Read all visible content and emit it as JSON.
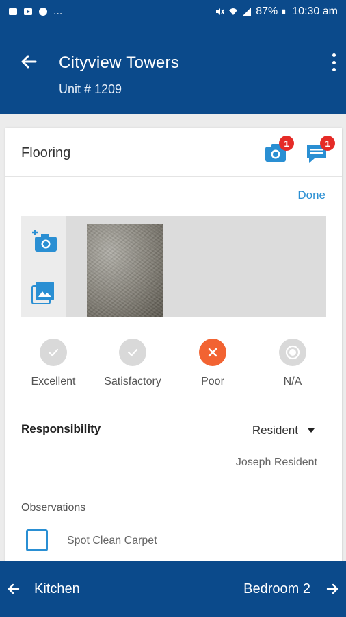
{
  "status_bar": {
    "battery": "87%",
    "time": "10:30 am",
    "overflow": "..."
  },
  "header": {
    "title": "Cityview Towers",
    "subtitle": "Unit # 1209"
  },
  "card": {
    "title": "Flooring",
    "camera_badge": "1",
    "comment_badge": "1",
    "done_label": "Done"
  },
  "ratings": [
    {
      "label": "Excellent",
      "state": "unselected"
    },
    {
      "label": "Satisfactory",
      "state": "unselected"
    },
    {
      "label": "Poor",
      "state": "selected"
    },
    {
      "label": "N/A",
      "state": "unselected"
    }
  ],
  "responsibility": {
    "label": "Responsibility",
    "selected": "Resident",
    "person": "Joseph Resident"
  },
  "observations": {
    "title": "Observations",
    "items": [
      {
        "label": "Spot Clean Carpet",
        "checked": false
      }
    ]
  },
  "bottom_nav": {
    "prev_label": "Kitchen",
    "next_label": "Bedroom 2"
  },
  "colors": {
    "primary": "#0b4a8b",
    "accent": "#2a8fd3",
    "poor": "#f26332",
    "badge": "#e52b27",
    "neutral_circle": "#d9d9d9"
  }
}
